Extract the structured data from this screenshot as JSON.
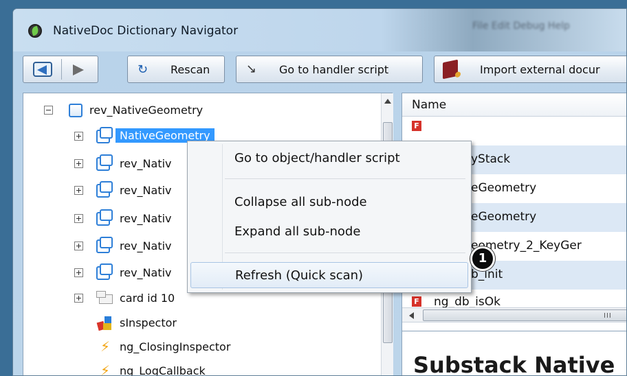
{
  "window": {
    "title": "NativeDoc Dictionary Navigator",
    "background_menu": "File  Edit  Debug  Help"
  },
  "toolbar": {
    "back_icon": "arrow-left-icon",
    "forward_icon": "arrow-right-icon",
    "rescan_label": "Rescan",
    "goto_label": "Go to handler script",
    "import_label": "Import external docur"
  },
  "tree": {
    "root": {
      "label": "rev_NativeGeometry",
      "expanded": true
    },
    "items": [
      {
        "label": "NativeGeometry",
        "selected": true
      },
      {
        "label": "rev_Nativ"
      },
      {
        "label": "rev_Nativ"
      },
      {
        "label": "rev_Nativ"
      },
      {
        "label": "rev_Nativ"
      },
      {
        "label": "rev_Nativ"
      },
      {
        "label": "card id 10"
      },
      {
        "label": "sInspector"
      },
      {
        "label": "ng_ClosingInspector"
      },
      {
        "label": "ng_LogCallback"
      }
    ]
  },
  "list": {
    "column_header": "Name",
    "rows": [
      {
        "label": ""
      },
      {
        "label": "yStack"
      },
      {
        "label": "eGeometry"
      },
      {
        "label": "eGeometry"
      },
      {
        "label": "eometry_2_KeyGer"
      },
      {
        "label": "b_init"
      },
      {
        "label": "ng_db_isOk"
      }
    ],
    "hscroll_grip": "III"
  },
  "bottom_pane": {
    "heading": "Substack Native"
  },
  "context_menu": {
    "items": [
      {
        "label": "Go to object/handler script"
      },
      {
        "label": "Collapse all sub-node"
      },
      {
        "label": "Expand all sub-node"
      },
      {
        "label": "Refresh (Quick scan)",
        "highlighted": true
      }
    ]
  },
  "callout": {
    "number": "1"
  }
}
